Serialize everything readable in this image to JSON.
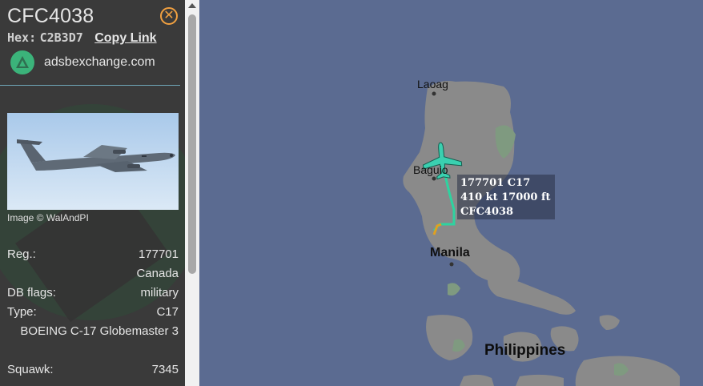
{
  "sidebar": {
    "callsign": "CFC4038",
    "hex_label": "Hex:",
    "hex_value": "C2B3D7",
    "copy_link": "Copy Link",
    "source": "adsbexchange.com",
    "photo_credit": "Image © WalAndPI",
    "details": {
      "reg_label": "Reg.:",
      "reg_value": "177701",
      "country": "Canada",
      "dbflags_label": "DB flags:",
      "dbflags_value": "military",
      "type_label": "Type:",
      "type_value": "C17",
      "type_desc": "BOEING C-17 Globemaster 3",
      "squawk_label": "Squawk:",
      "squawk_value": "7345"
    },
    "close_icon": "close-circle-icon"
  },
  "map": {
    "cities": {
      "laoag": "Laoag",
      "baguio": "Baguio",
      "manila": "Manila"
    },
    "country": "Philippines",
    "aircraft_label": {
      "line1": "177701 C17",
      "line2": "410 kt  17000 ft",
      "line3": "CFC4038"
    },
    "colors": {
      "water": "#5b6b91",
      "land": "#8a8a8a",
      "park": "#7f9a80",
      "track": "#2ed3a0",
      "aircraft": "#3ad0b0"
    }
  }
}
